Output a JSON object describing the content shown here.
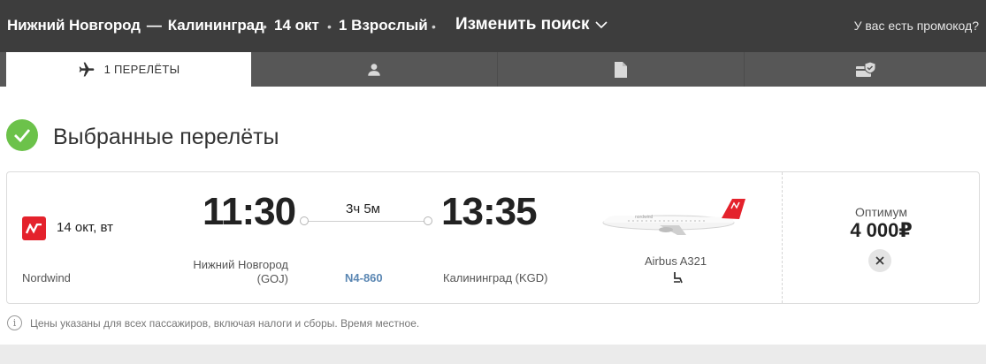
{
  "header": {
    "origin": "Нижний Новгород",
    "separator": "—",
    "destination": "Калининград",
    "bullet": "•",
    "date": "14 окт",
    "passengers": "1 Взрослый",
    "change_search": "Изменить поиск",
    "promo": "У вас есть промокод?"
  },
  "tabs": [
    {
      "icon": "airplane-icon",
      "label": "1 ПЕРЕЛЁТЫ",
      "active": true
    },
    {
      "icon": "person-icon",
      "label": "",
      "active": false
    },
    {
      "icon": "document-icon",
      "label": "",
      "active": false
    },
    {
      "icon": "payment-icon",
      "label": "",
      "active": false
    }
  ],
  "section": {
    "title": "Выбранные перелёты",
    "icon": "checkmark-icon"
  },
  "flight": {
    "date": "14 окт, вт",
    "airline": "Nordwind",
    "departure_time": "11:30",
    "arrival_time": "13:35",
    "duration": "3ч 5м",
    "departure_city": "Нижний Новгород",
    "departure_code": "(GOJ)",
    "arrival_city": "Калининград (KGD)",
    "flight_number": "N4-860",
    "aircraft": "Airbus A321",
    "aircraft_icon": "airplane-image",
    "amenity_icon": "seat-icon",
    "fare_name": "Оптимум",
    "price": "4 000₽"
  },
  "note": "Цены указаны для всех пассажиров, включая налоги и сборы. Время местное.",
  "colors": {
    "header_bg": "#3d3d3d",
    "tabs_bg": "#575757",
    "check_green": "#6cc24a",
    "airline_red": "#e4222c",
    "flight_number": "#5b87b3"
  }
}
